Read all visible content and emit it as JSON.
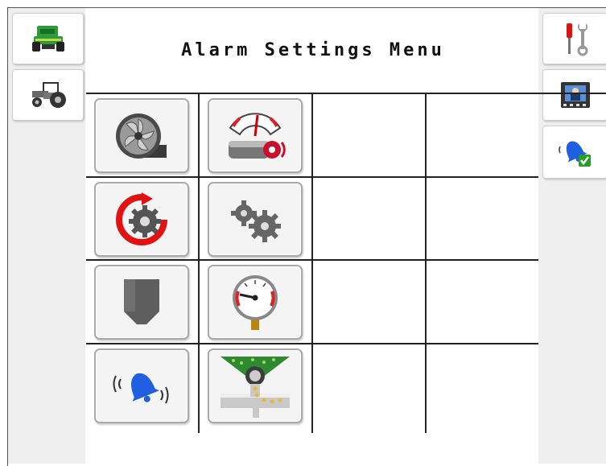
{
  "screen": {
    "title": "Alarm Settings Menu"
  },
  "left_tabs": [
    {
      "name": "sprayer-machine-tab",
      "icon": "sprayer-machine-icon"
    },
    {
      "name": "tractor-tab",
      "icon": "tractor-icon"
    }
  ],
  "right_tabs": [
    {
      "name": "tools-tab",
      "icon": "wrench-screwdriver-icon"
    },
    {
      "name": "display-settings-tab",
      "icon": "operator-screen-icon"
    },
    {
      "name": "alarm-settings-tab",
      "icon": "alarm-bell-check-icon",
      "active": true
    }
  ],
  "tiles": [
    {
      "name": "fan-alarm-button",
      "icon": "fan-icon"
    },
    {
      "name": "shaft-speed-alarm-button",
      "icon": "rpm-gauge-shaft-icon"
    },
    {
      "name": "rotation-alarm-button",
      "icon": "rotating-gear-icon"
    },
    {
      "name": "gearbox-alarm-button",
      "icon": "gears-icon"
    },
    {
      "name": "bin-level-alarm-button",
      "icon": "hopper-icon"
    },
    {
      "name": "pressure-alarm-button",
      "icon": "pressure-gauge-icon"
    },
    {
      "name": "alarm-sound-button",
      "icon": "ringing-bell-icon"
    },
    {
      "name": "metering-alarm-button",
      "icon": "meter-roller-icon"
    }
  ]
}
